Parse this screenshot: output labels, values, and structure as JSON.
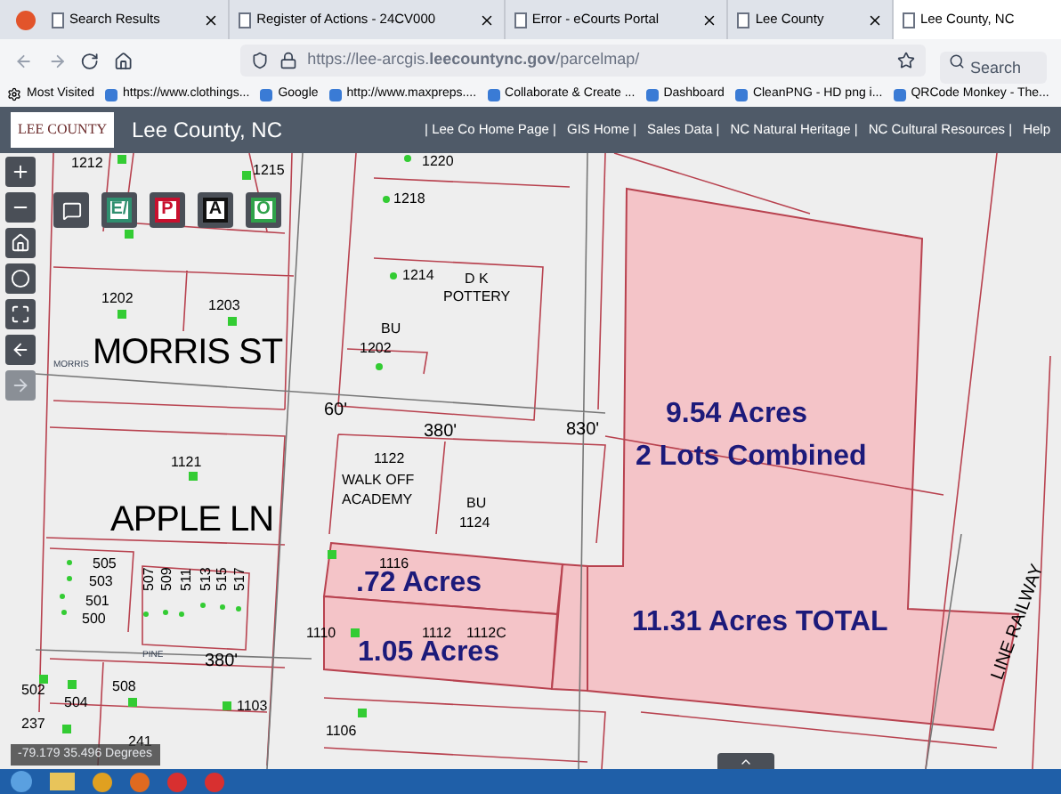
{
  "tabs": [
    {
      "label": "Search Results",
      "selected": false
    },
    {
      "label": "Register of Actions - 24CV000",
      "selected": false
    },
    {
      "label": "Error - eCourts Portal",
      "selected": false
    },
    {
      "label": "Lee County",
      "selected": false
    },
    {
      "label": "Lee County, NC",
      "selected": true
    }
  ],
  "address_bar": {
    "url": "https://lee-arcgis.**leecountync.gov**/parcelmap/",
    "search_placeholder": "Search"
  },
  "bookmarks": [
    "Most Visited",
    "https://www.clothings...",
    "Google",
    "http://www.maxpreps....",
    "Collaborate & Create ...",
    "Dashboard",
    "CleanPNG - HD png i...",
    "QRCode Monkey - The..."
  ],
  "app_header": {
    "logo_text": "LEE COUNTY",
    "title": "Lee County, NC",
    "nav": [
      "| Lee Co Home Page |",
      "GIS Home |",
      "Sales Data |",
      "NC Natural Heritage |",
      "NC Cultural Resources |",
      "Help"
    ]
  },
  "toolbar": [
    {
      "kind": "comment"
    },
    {
      "kind": "letter",
      "label": "E/",
      "color": "#2f8f6f"
    },
    {
      "kind": "letter",
      "label": "P",
      "color": "#c8102e"
    },
    {
      "kind": "letter",
      "label": "A",
      "color": "#111111"
    },
    {
      "kind": "letter",
      "label": "O",
      "color": "#2fa24a"
    }
  ],
  "map_controls": [
    {
      "kind": "zoom_in",
      "disabled": false
    },
    {
      "kind": "zoom_out",
      "disabled": false
    },
    {
      "kind": "home",
      "disabled": false
    },
    {
      "kind": "locate",
      "disabled": false
    },
    {
      "kind": "fullscreen",
      "disabled": false
    },
    {
      "kind": "back",
      "disabled": false
    },
    {
      "kind": "forward",
      "disabled": true
    }
  ],
  "map_labels": [
    {
      "text": "1212",
      "kind": "lot"
    },
    {
      "text": "1215",
      "kind": "lot"
    },
    {
      "text": "1220",
      "kind": "lot"
    },
    {
      "text": "1218",
      "kind": "lot"
    },
    {
      "text": "1214",
      "kind": "lot"
    },
    {
      "text": "D K",
      "kind": "business"
    },
    {
      "text": "POTTERY",
      "kind": "business"
    },
    {
      "text": "BU",
      "kind": "business"
    },
    {
      "text": "1202",
      "kind": "lot"
    },
    {
      "text": "1202",
      "kind": "lot"
    },
    {
      "text": "1203",
      "kind": "lot"
    },
    {
      "text": "MORRIS",
      "kind": "tiny"
    },
    {
      "text": "MORRIS ST",
      "kind": "street"
    },
    {
      "text": "60'",
      "kind": "dimension"
    },
    {
      "text": "380'",
      "kind": "dimension"
    },
    {
      "text": "830'",
      "kind": "dimension"
    },
    {
      "text": "1121",
      "kind": "lot"
    },
    {
      "text": "1122",
      "kind": "lot"
    },
    {
      "text": "WALK OFF",
      "kind": "business"
    },
    {
      "text": "ACADEMY",
      "kind": "business"
    },
    {
      "text": "BU",
      "kind": "business"
    },
    {
      "text": "1124",
      "kind": "lot"
    },
    {
      "text": "APPLE LN",
      "kind": "street"
    },
    {
      "text": "505",
      "kind": "lot"
    },
    {
      "text": "503",
      "kind": "lot"
    },
    {
      "text": "501",
      "kind": "lot"
    },
    {
      "text": "500",
      "kind": "lot"
    },
    {
      "text": "507",
      "kind": "vertical"
    },
    {
      "text": "509",
      "kind": "vertical"
    },
    {
      "text": "511",
      "kind": "vertical"
    },
    {
      "text": "513",
      "kind": "vertical"
    },
    {
      "text": "515",
      "kind": "vertical"
    },
    {
      "text": "517",
      "kind": "vertical"
    },
    {
      "text": "380'",
      "kind": "dimension"
    },
    {
      "text": "PINE",
      "kind": "tiny"
    },
    {
      "text": "1116",
      "kind": "lot"
    },
    {
      "text": ".72 Acres",
      "kind": "acreage"
    },
    {
      "text": "1110",
      "kind": "lot"
    },
    {
      "text": "1112",
      "kind": "lot"
    },
    {
      "text": "1112C",
      "kind": "lot"
    },
    {
      "text": "1.05 Acres",
      "kind": "acreage"
    },
    {
      "text": "9.54 Acres",
      "kind": "acreage"
    },
    {
      "text": "2 Lots Combined",
      "kind": "acreage"
    },
    {
      "text": "11.31 Acres TOTAL",
      "kind": "acreage"
    },
    {
      "text": "502",
      "kind": "lot"
    },
    {
      "text": "504",
      "kind": "lot"
    },
    {
      "text": "508",
      "kind": "lot"
    },
    {
      "text": "1103",
      "kind": "lot"
    },
    {
      "text": "237",
      "kind": "lot"
    },
    {
      "text": "241",
      "kind": "lot"
    },
    {
      "text": "1106",
      "kind": "lot"
    },
    {
      "text": "LINE RAILWAY",
      "kind": "railway"
    }
  ],
  "coordinates": "-79.179 35.496 Degrees"
}
